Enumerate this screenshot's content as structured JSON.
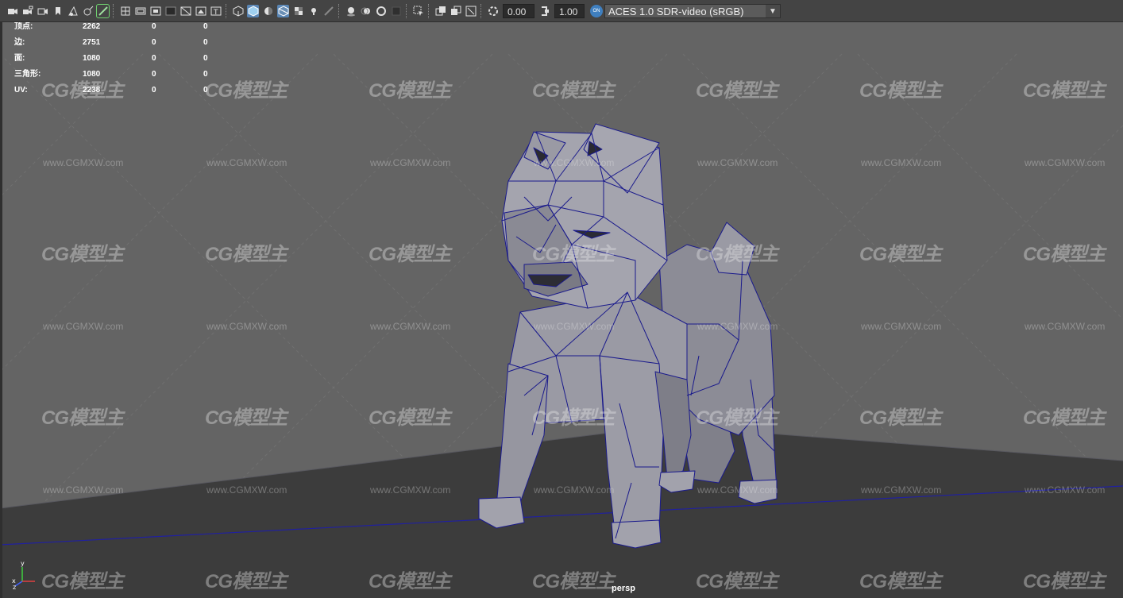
{
  "toolbar": {
    "exposure_value": "0.00",
    "gamma_value": "1.00",
    "color_space": "ACES 1.0 SDR-video (sRGB)",
    "colormanage_icon_text": "ON"
  },
  "hud": {
    "rows": [
      {
        "label": "顶点:",
        "v1": "2262",
        "v2": "0",
        "v3": "0"
      },
      {
        "label": "边:",
        "v1": "2751",
        "v2": "0",
        "v3": "0"
      },
      {
        "label": "面:",
        "v1": "1080",
        "v2": "0",
        "v3": "0"
      },
      {
        "label": "三角形:",
        "v1": "1080",
        "v2": "0",
        "v3": "0"
      },
      {
        "label": "UV:",
        "v1": "2238",
        "v2": "0",
        "v3": "0"
      }
    ]
  },
  "viewport": {
    "camera": "persp",
    "axis_labels": {
      "x": "x",
      "y": "y",
      "z": "z"
    }
  },
  "watermark": {
    "logo": "CG模型主",
    "url": "www.CGMXW.com"
  },
  "icons": [
    "camera-icon",
    "camera-lock-icon",
    "camera-attributes-icon",
    "bookmark-icon",
    "image-plane-icon",
    "2d-pan-zoom-icon",
    "grease-pencil-icon",
    "grid-icon",
    "film-gate-icon",
    "resolution-gate-icon",
    "gate-mask-icon",
    "field-chart-icon",
    "safe-action-icon",
    "safe-title-icon",
    "wireframe-icon",
    "smooth-shade-icon",
    "default-material-icon",
    "wireframe-on-shaded-icon",
    "textured-icon",
    "lights-icon",
    "shadows-icon",
    "screen-space-ao-icon",
    "motion-blur-icon",
    "antialiasing-icon",
    "depth-of-field-icon",
    "isolate-select-icon",
    "xray-icon",
    "xray-active-components-icon",
    "xray-joints-icon",
    "exposure-icon",
    "gamma-icon",
    "colormanage-icon"
  ],
  "colors": {
    "viewport_bg": "#646464",
    "floor": "#3c3c3c",
    "wireframe": "#1a1a8c",
    "toolbar_bg": "#444444"
  }
}
